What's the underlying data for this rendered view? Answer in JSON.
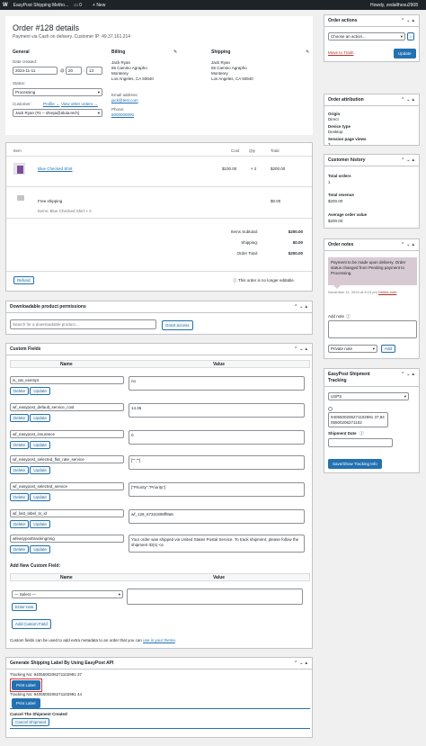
{
  "adminbar": {
    "site": "EasyPost Shipping Metho...",
    "comments": "0",
    "new": "+ New",
    "howdy": "Howdy, zedalthexu2908"
  },
  "order": {
    "title": "Order #128 details",
    "subtitle": "Payment via Cash on delivery. Customer IP: 49.37.161.214",
    "general_h": "General",
    "billing_h": "Billing",
    "shipping_h": "Shipping",
    "date_label": "Date created:",
    "date": "2024-11-11",
    "at": "@",
    "hour": "20",
    "minute": "13",
    "status_label": "Status:",
    "status": "Processing",
    "customer_label": "Customer:",
    "profile_link": "Profile →",
    "view_orders_link": "View other orders →",
    "customer": "Jack Ryan (#1 – shreja@alula.tech)",
    "billing": [
      "Jack Ryan",
      "55 Camino Agrapho",
      "Monterey",
      "Los Angeles, CA 93940"
    ],
    "email_label": "Email address:",
    "email": "jack@test.com",
    "phone_label": "Phone:",
    "phone": "5000000000",
    "shipping": [
      "Jack Ryan",
      "55 Camino Agrapho",
      "Monterey",
      "Los Angeles, CA 93940"
    ]
  },
  "items": {
    "col_item": "Item",
    "col_cost": "Cost",
    "col_qty": "Qty",
    "col_total": "Total",
    "product": "Blue Checked Shirt",
    "cost": "$100.00",
    "qty": "× 2",
    "total": "$200.00",
    "ship_name": "Free shipping",
    "ship_total": "$0.00",
    "ship_items_label": "Items:",
    "ship_items": "Blue Checked Shirt × 2",
    "subtotal_label": "Items Subtotal:",
    "subtotal": "$200.00",
    "shipping_label": "Shipping:",
    "shipping": "$0.00",
    "total_label": "Order Total:",
    "refund": "Refund",
    "not_editable": "This order is no longer editable."
  },
  "downloads": {
    "title": "Downloadable product permissions",
    "placeholder": "Search for a downloadable product...",
    "grant": "Grant access"
  },
  "custom": {
    "title": "Custom Fields",
    "col_name": "Name",
    "col_value": "Value",
    "delete": "Delete",
    "update": "Update",
    "fields": [
      {
        "name": "is_vat_exempt",
        "value": "no"
      },
      {
        "name": "wf_easypost_default_service_cost",
        "value": "14.36"
      },
      {
        "name": "wf_easypost_insurance",
        "value": "0"
      },
      {
        "name": "wf_easypost_selected_flat_rate_service",
        "value": "[\"\",\"\"]"
      },
      {
        "name": "wf_easypost_selected_service",
        "value": "[\"Priority\",\"Priority\"]"
      },
      {
        "name": "wf_last_label_tx_id",
        "value": "wf_128_6732c808ff8a6"
      },
      {
        "name": "wfeasyposttrackingmsg",
        "value": "Your order was shipped via United States Postal Service. To track shipment, please follow the shipment ID(s) <a"
      }
    ],
    "add_title": "Add New Custom Field:",
    "select": "— Select —",
    "enter_new": "Enter new",
    "add_button": "Add Custom Field",
    "note_prefix": "Custom fields can be used to add extra metadata to an order that you can ",
    "note_link": "use in your theme",
    "note_suffix": "."
  },
  "label_box": {
    "title": "Generate Shipping Label By Using EasyPost API",
    "tracking1": "Tracking No: 9405500206271102991 37",
    "print1": "Print Label",
    "tracking2": "Tracking No: 9405500206271102991 44",
    "print2": "Print Label",
    "cancel_title": "Cancel The Shipment Created",
    "cancel_button": "Cancel Shipment"
  },
  "actions": {
    "title": "Order actions",
    "choose": "Choose an action...",
    "trash": "Move to Trash",
    "update": "Update"
  },
  "attribution": {
    "title": "Order attribution",
    "origin_label": "Origin",
    "origin": "Direct",
    "device_label": "Device type",
    "device": "Desktop",
    "session_label": "Session page views",
    "session": "3"
  },
  "history": {
    "title": "Customer history",
    "orders_label": "Total orders",
    "orders": "1",
    "revenue_label": "Total revenue",
    "revenue": "$200.00",
    "avg_label": "Average order value",
    "avg": "$200.00"
  },
  "notes": {
    "title": "Order notes",
    "note": "Payment to be made upon delivery. Order status changed from Pending payment to Processing.",
    "meta": "November 11, 2024 at 8:13 pm",
    "delete": "Delete note",
    "add_label": "Add note",
    "type": "Private note",
    "add": "Add"
  },
  "tracking": {
    "title": "EasyPost Shipment Tracking",
    "carrier": "USPS",
    "numbers": [
      "9405500206271102991 37,9405500206271102"
    ],
    "date_label": "Shipment Date",
    "button": "Save/Show Tracking Info"
  },
  "colors": {
    "accent": "#2271b1",
    "note_bg": "#d7cad2",
    "danger": "#b32d2e"
  }
}
